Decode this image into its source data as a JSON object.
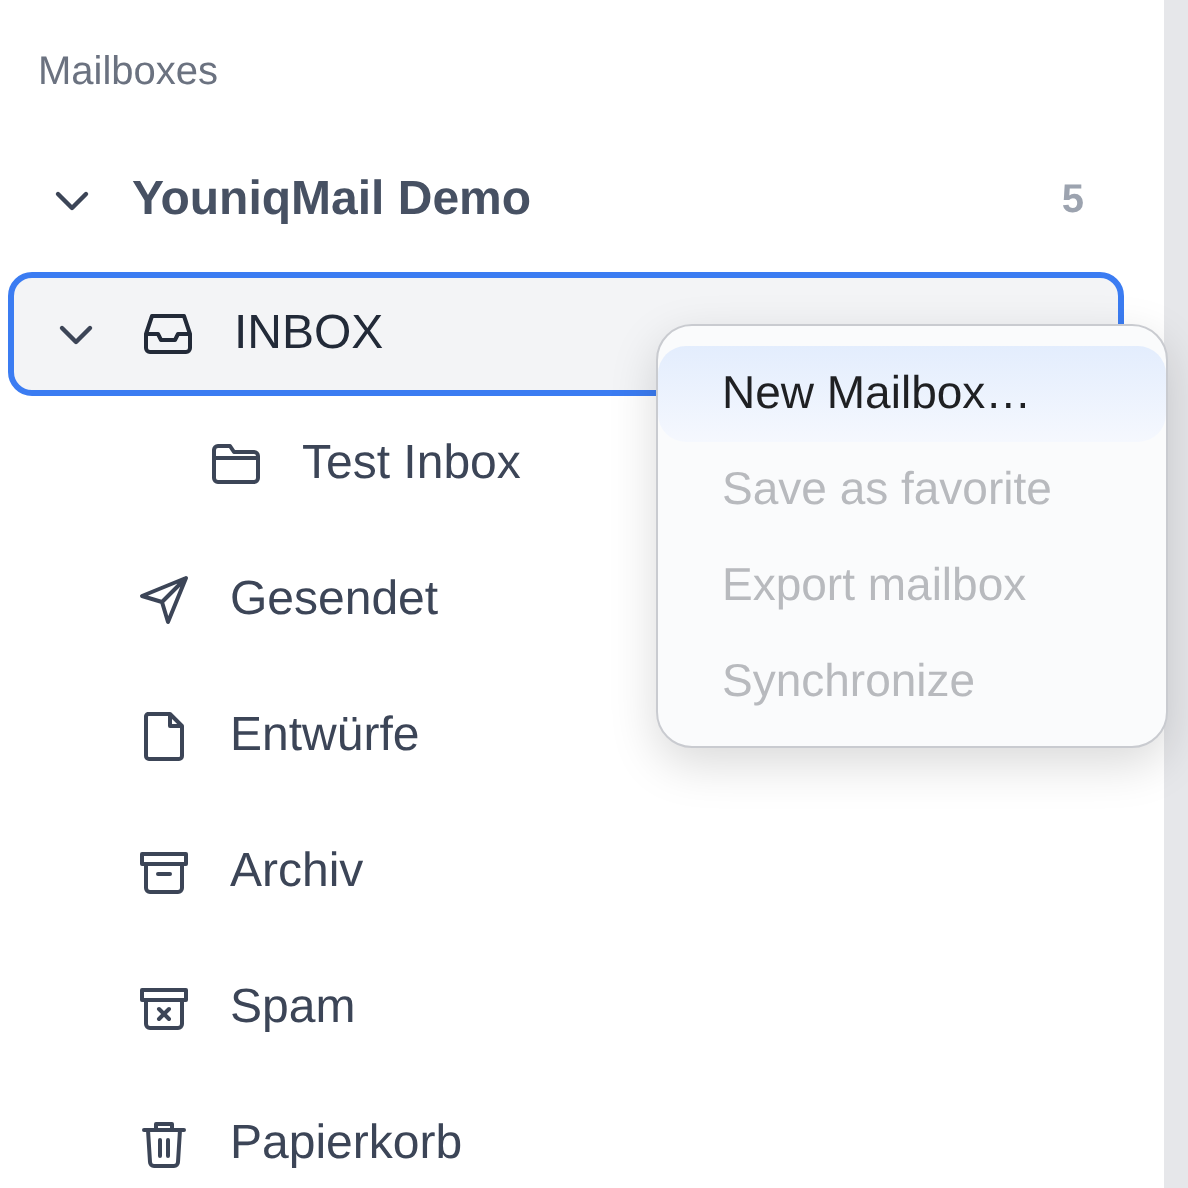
{
  "sidebar": {
    "heading": "Mailboxes",
    "accounts": [
      {
        "name": "YouniqMail Demo",
        "count": "5",
        "expanded": true,
        "folders": [
          {
            "label": "INBOX",
            "kind": "inbox",
            "selected": true,
            "expanded": true,
            "children": [
              {
                "label": "Test Inbox",
                "kind": "folder",
                "selected": false
              }
            ]
          },
          {
            "label": "Gesendet",
            "kind": "send",
            "selected": false
          },
          {
            "label": "Entwürfe",
            "kind": "draft",
            "selected": false
          },
          {
            "label": "Archiv",
            "kind": "archive",
            "selected": false
          },
          {
            "label": "Spam",
            "kind": "spam",
            "selected": false
          },
          {
            "label": "Papierkorb",
            "kind": "trash",
            "selected": false
          }
        ]
      }
    ]
  },
  "context_menu": {
    "items": [
      {
        "label": "New Mailbox…",
        "disabled": false,
        "selected": true
      },
      {
        "label": "Save as favorite",
        "disabled": true,
        "selected": false
      },
      {
        "label": "Export mailbox",
        "disabled": true,
        "selected": false
      },
      {
        "label": "Synchronize",
        "disabled": true,
        "selected": false
      }
    ]
  }
}
